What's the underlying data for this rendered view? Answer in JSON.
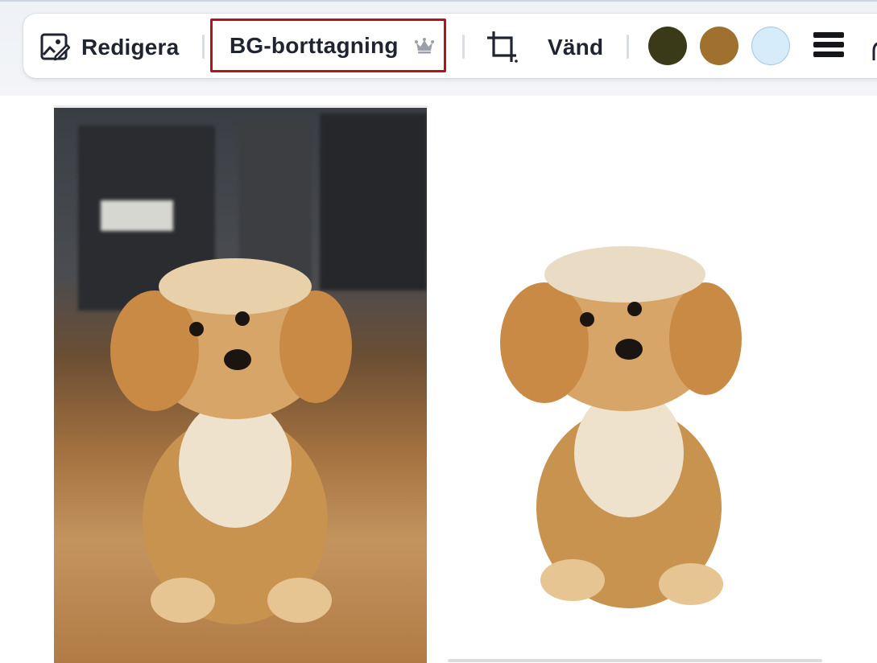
{
  "toolbar": {
    "edit_label": "Redigera",
    "bg_removal_label": "BG-borttagning",
    "flip_label": "Vänd",
    "icons": {
      "edit": "image-edit-icon",
      "premium": "crown-icon",
      "crop": "crop-icon",
      "menu": "menu-lines-icon",
      "more": "animate-icon"
    },
    "swatches": [
      "#3a3a18",
      "#a0702e",
      "#d6ecfb"
    ],
    "highlight_color": "#b3141b"
  },
  "canvas": {
    "original_image": "photo-puppy-original",
    "cutout_image": "photo-puppy-background-removed"
  }
}
